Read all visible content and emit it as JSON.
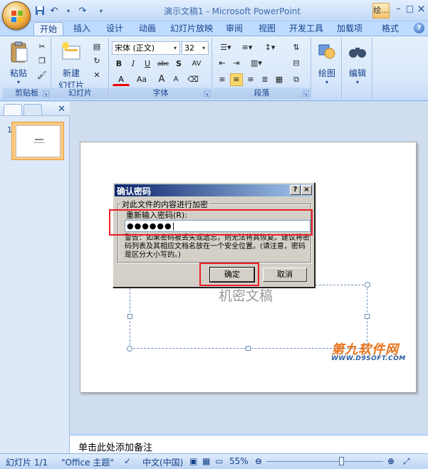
{
  "window": {
    "title": "演示文稿1 - Microsoft PowerPoint",
    "tab_fragment": "绘...",
    "controls": {
      "minimize": "–",
      "maximize": "□",
      "close": "×"
    }
  },
  "ribbon": {
    "tabs": [
      "开始",
      "插入",
      "设计",
      "动画",
      "幻灯片放映",
      "审阅",
      "视图",
      "开发工具",
      "加载项",
      "格式"
    ],
    "active_tab": "开始",
    "groups": {
      "clipboard": {
        "label": "剪贴板",
        "paste": "粘贴"
      },
      "slides": {
        "label": "幻灯片",
        "new_slide_line1": "新建",
        "new_slide_line2": "幻灯片"
      },
      "font": {
        "label": "字体",
        "font_name": "宋体 (正文)",
        "font_size": "32",
        "bold": "B",
        "italic": "I",
        "underline": "U",
        "strike": "abc",
        "shadow": "S",
        "spacing": "AV",
        "font_color": "A",
        "case": "Aa",
        "grow": "A",
        "shrink": "A"
      },
      "paragraph": {
        "label": "段落"
      },
      "drawing": {
        "label": "绘图"
      },
      "editing": {
        "label": "编辑"
      }
    }
  },
  "left_panel": {
    "slide_number": "1"
  },
  "slide": {
    "placeholder_text": "机密文稿",
    "watermark_text": "第九软件网",
    "watermark_url": "WWW.D9SOFT.COM"
  },
  "notes": {
    "placeholder": "单击此处添加备注"
  },
  "status": {
    "slide_count": "幻灯片 1/1",
    "theme": "\"Office 主题\"",
    "language": "中文(中国)",
    "zoom": "55%"
  },
  "dialog": {
    "title": "确认密码",
    "help": "?",
    "close": "×",
    "group_title": "对此文件的内容进行加密",
    "label": "重新输入密码(R):",
    "password_value": "●●●●●●|",
    "warning": "警告：如果密码被丢失或遗忘，则无法将其恢复。建议将密码列表及其相应文档名放在一个安全位置。(请注意，密码是区分大小写的。)",
    "ok": "确定",
    "cancel": "取消"
  },
  "colors": {
    "highlight_red": "#ee1c25",
    "watermark_orange": "#e8731b",
    "ribbon_blue": "#15428b"
  }
}
